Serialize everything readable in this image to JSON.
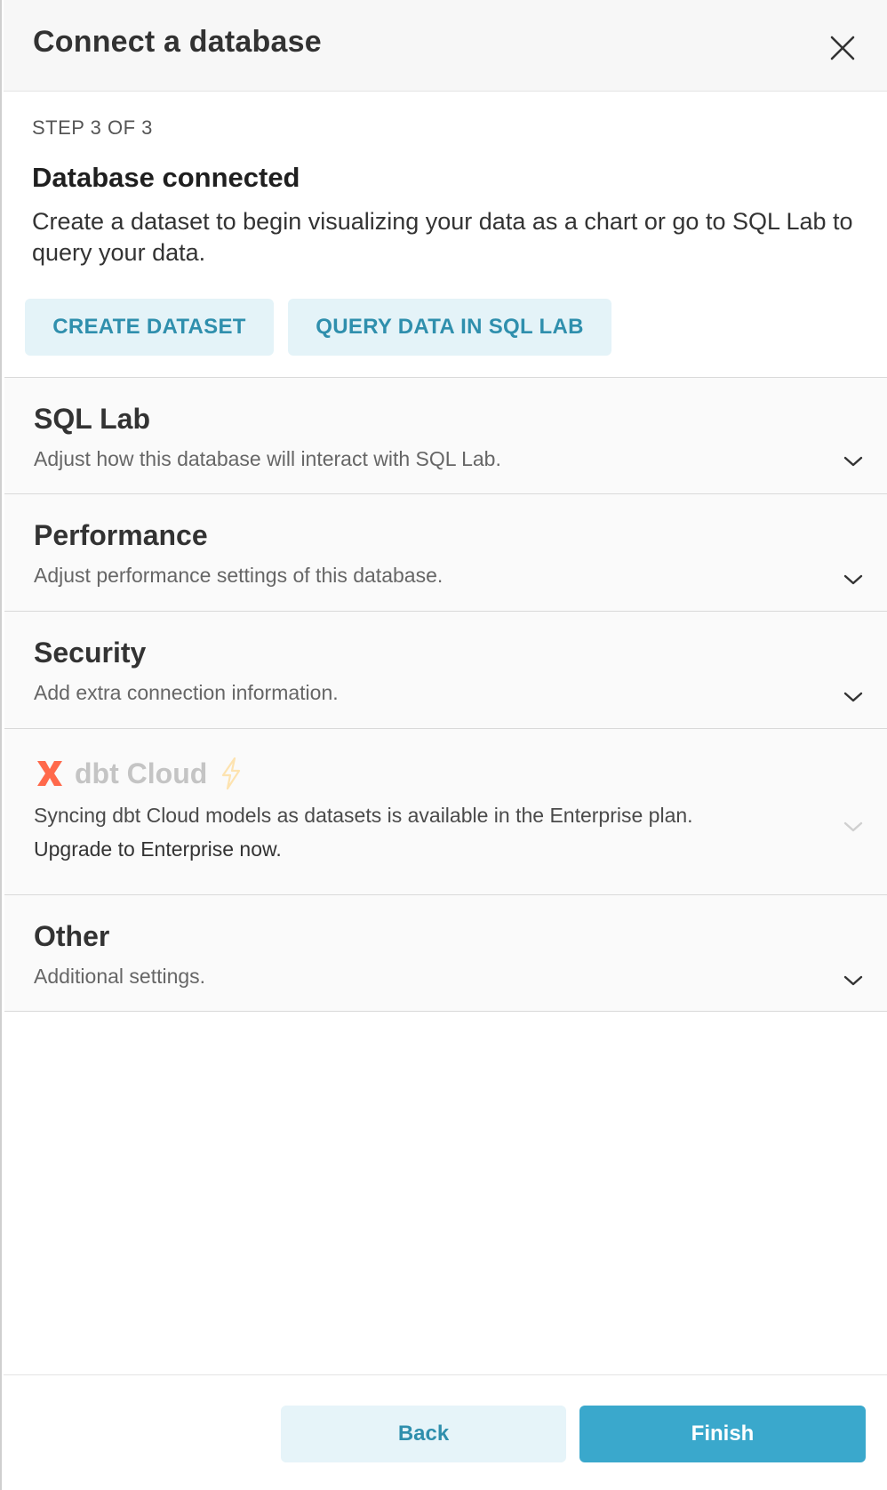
{
  "header": {
    "title": "Connect a database",
    "close_icon": "close-icon"
  },
  "step": {
    "label": "STEP 3 OF 3",
    "title": "Database connected",
    "description": "Create a dataset to begin visualizing your data as a chart or go to SQL Lab to query your data."
  },
  "actions": {
    "create_dataset": "CREATE DATASET",
    "query_sql_lab": "QUERY DATA IN SQL LAB"
  },
  "panels": [
    {
      "title": "SQL Lab",
      "subtitle": "Adjust how this database will interact with SQL Lab."
    },
    {
      "title": "Performance",
      "subtitle": "Adjust performance settings of this database."
    },
    {
      "title": "Security",
      "subtitle": "Add extra connection information."
    },
    {
      "title": "dbt Cloud",
      "subtitle": "Syncing dbt Cloud models as datasets is available in the Enterprise plan.",
      "subtitle_2": "Upgrade to Enterprise now.",
      "disabled": true
    },
    {
      "title": "Other",
      "subtitle": "Additional settings."
    }
  ],
  "footer": {
    "back": "Back",
    "finish": "Finish"
  },
  "colors": {
    "accent": "#3aa8cc",
    "accent_light": "#e4f3f8",
    "accent_text": "#2f8fad",
    "dbt_brand": "#ff694b",
    "bolt": "#fde3b0"
  }
}
